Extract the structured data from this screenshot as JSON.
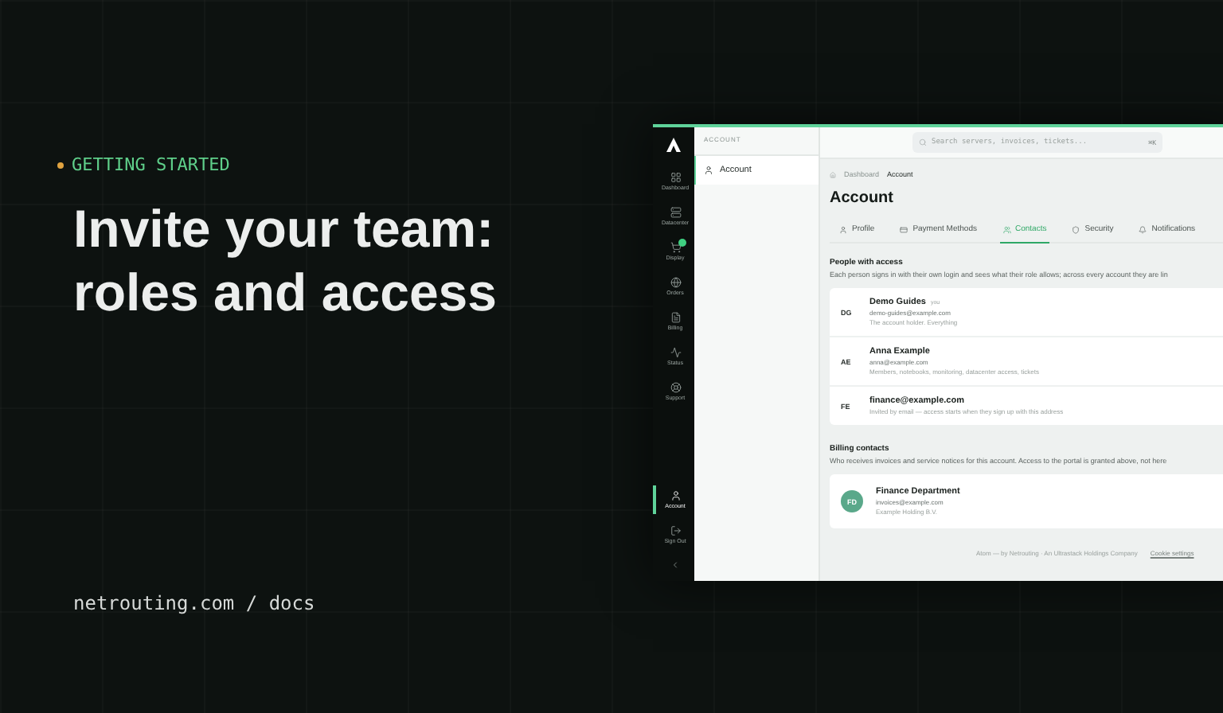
{
  "hero": {
    "eyebrow": "GETTING STARTED",
    "title_lines": [
      "Invite your team:",
      "roles and access"
    ],
    "footer": "netrouting.com / docs"
  },
  "app": {
    "nav_top": [
      {
        "label": "Dashboard",
        "selected": false
      },
      {
        "label": "Datacenter",
        "selected": false
      },
      {
        "label": "Display",
        "selected": false,
        "has_badge": true
      },
      {
        "label": "Orders",
        "selected": false
      },
      {
        "label": "Billing",
        "selected": false
      },
      {
        "label": "Status",
        "selected": false
      },
      {
        "label": "Support",
        "selected": false
      }
    ],
    "nav_bottom": [
      {
        "label": "Account",
        "selected": true
      },
      {
        "label": "Sign Out",
        "selected": false
      }
    ],
    "panel_header": "ACCOUNT",
    "panel_items": [
      {
        "label": "Account",
        "selected": true
      }
    ],
    "search": {
      "placeholder": "Search servers, invoices, tickets...",
      "shortcut": "⌘K"
    },
    "breadcrumb": [
      "Dashboard",
      "Account"
    ],
    "page_title": "Account",
    "tabs": [
      {
        "label": "Profile",
        "selected": false
      },
      {
        "label": "Payment Methods",
        "selected": false
      },
      {
        "label": "Contacts",
        "selected": true
      },
      {
        "label": "Security",
        "selected": false
      },
      {
        "label": "Notifications",
        "selected": false
      }
    ],
    "people": {
      "title": "People with access",
      "description": "Each person signs in with their own login and sees what their role allows; across every account they are lin",
      "rows": [
        {
          "initials": "DG",
          "name": "Demo Guides",
          "tag": "you",
          "email": "demo-guides@example.com",
          "note": "The account holder. Everything"
        },
        {
          "initials": "AE",
          "name": "Anna Example",
          "email": "anna@example.com",
          "note": "Members, notebooks, monitoring, datacenter access, tickets"
        },
        {
          "initials": "FE",
          "name": "finance@example.com",
          "note": "Invited by email — access starts when they sign up with this address"
        }
      ]
    },
    "billing": {
      "title": "Billing contacts",
      "description": "Who receives invoices and service notices for this account. Access to the portal is granted above, not here",
      "contacts": [
        {
          "initials": "FD",
          "name": "Finance Department",
          "email": "invoices@example.com",
          "company": "Example Holding B.V."
        }
      ]
    },
    "footer": {
      "text": "Atom — by Netrouting · An Ultrastack Holdings Company",
      "link": "Cookie settings"
    }
  }
}
